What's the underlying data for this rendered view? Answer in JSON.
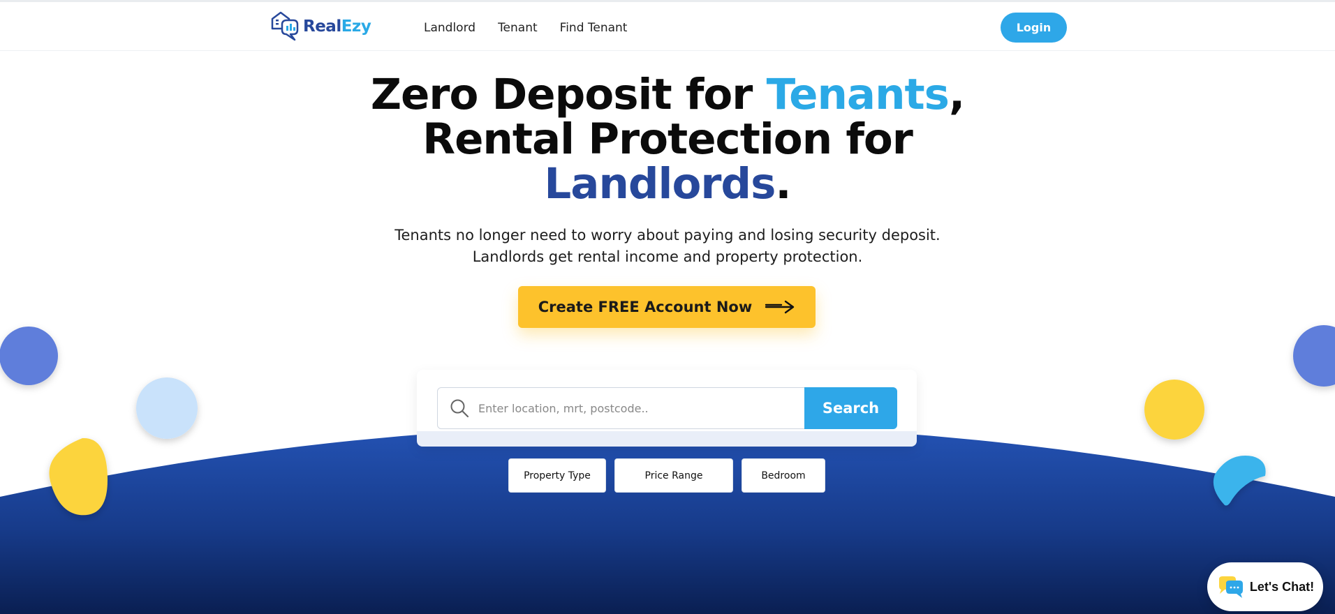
{
  "nav": {
    "logo": {
      "part1": "Real",
      "part2": "Ezy"
    },
    "links": [
      "Landlord",
      "Tenant",
      "Find Tenant"
    ],
    "login_label": "Login"
  },
  "hero": {
    "line1_prefix": "Zero Deposit for ",
    "line1_highlight": "Tenants",
    "line1_suffix": ",",
    "line2": "Rental Protection for",
    "line3_highlight": "Landlords",
    "line3_suffix": ".",
    "subtitle_line1": "Tenants no longer need to worry about paying and losing security deposit.",
    "subtitle_line2": "Landlords get rental income and property protection.",
    "cta_label": "Create FREE Account Now"
  },
  "search": {
    "placeholder": "Enter location, mrt, postcode..",
    "value": "",
    "button_label": "Search"
  },
  "filters": {
    "property_type": "Property Type",
    "price_range": "Price Range",
    "bedroom": "Bedroom"
  },
  "chat": {
    "label": "Let's Chat!"
  },
  "icons": {
    "logo": "house-chat-logo-icon",
    "cta": "arrow-right-icon",
    "search": "search-icon",
    "chat": "chat-bubbles-icon"
  },
  "colors": {
    "brand_dark_blue": "#27489b",
    "brand_light_blue": "#2ea7e8",
    "accent_yellow": "#fdc22c",
    "dome_blue": "#2453b5",
    "dome_navy": "#0a1f52"
  }
}
